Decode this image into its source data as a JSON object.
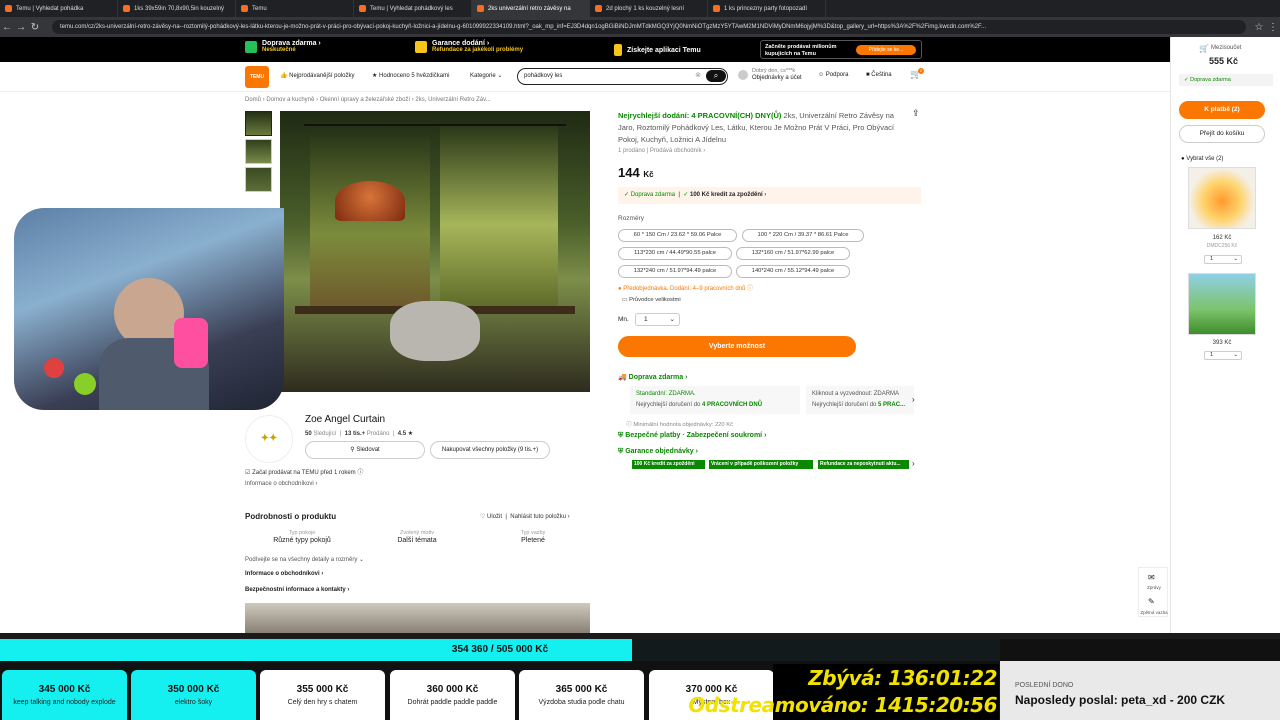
{
  "browser": {
    "tabs": [
      "Temu | Vyhledat pohádka",
      "1ks 39x59in 70,8x90,5in kouzelný",
      "Temu",
      "Temu | Vyhledat pohádkový les",
      "2ks univerzální retro závěsy na",
      "2d plochý 1 ks kouzelný lesní",
      "1 ks princezny party fotopozadí"
    ],
    "active_tab": 4,
    "url": "temu.com/cz/2ks-univerzální-retro-závěsy-na--roztomilý-pohádkový-les-látku-kterou-je-možno-prát-v-práci-pro-obývací-pokoj-kuchyň-ložnici-a-jídelnu-g-601099922334109.html?_oak_mp_inf=EJ3D4dqn1ogBGiBiNDJmMTdkMGQ3YjQ0NmNiOTgzMzY5YTAwM2M1NDViMyDNmM6ojyjM%3D&top_gallery_url=https%3A%2F%2Fimg.kwcdn.com%2F..."
  },
  "promo": {
    "free_shipping": "Doprava zdarma",
    "free_shipping_sub": "Neskutečné",
    "guarantee": "Garance dodání",
    "guarantee_sub": "Refundace za jakékoli problémy",
    "app": "Získejte aplikaci Temu",
    "selling_title": "Začněte prodávat milionům kupujících na Temu",
    "selling_cta": "Přidejte se ke..."
  },
  "header": {
    "logo": "TEMU",
    "bestsellers": "Nejprodávanější položky",
    "rated": "Hodnoceno 5 hvězdičkami",
    "categories": "Kategorie",
    "search_value": "pohádkový les",
    "account_line1": "Dobrý den, cs***k",
    "account_line2": "Objednávky a účet",
    "support": "Podpora",
    "language": "Čeština",
    "cart_count": "2"
  },
  "breadcrumb": "Domů  ›  Domov a kuchyně  ›  Okenní úpravy a železářské zboží  ›  2ks, Univerzální Retro Záv...",
  "product": {
    "delivery_prefix": "Nejrychlejší dodání: 4 PRACOVNÍ(CH) DNY(Ů)",
    "title": "2ks, Univerzální Retro Závěsy na Jaro, Roztomilý Pohádkový Les, Látku, Kterou Je Možno Prát V Práci, Pro Obývací Pokoj, Kuchyň, Ložnici A Jídelnu",
    "sold": "1 prodáno  |  Prodává obchodník",
    "price": "144",
    "currency": "Kč",
    "benefit_1": "Doprava zdarma",
    "benefit_2": "100 Kč kredit za zpoždění",
    "sizes_label": "Rozměry",
    "sizes": [
      "60 * 150 Cm / 23.62 * 59.06 Palce",
      "100 * 220 Cm / 39.37 * 86.61 Palce",
      "113*230 cm / 44.49*90.55 palce",
      "132*160 cm / 51.97*62.99 palce",
      "132*240 cm / 51.97*94.49 palce",
      "140*240 cm / 55.12*94.49 palce"
    ],
    "preorder": "Předobjednávka. Dodání: 4–9 pracovních dnů",
    "size_guide": "Průvodce velikostmi",
    "qty_label": "Mn.",
    "qty_value": "1",
    "cta": "Vyberte možnost",
    "shipping_title": "Doprava zdarma",
    "ship_std_1": "Standardní: ZDARMA.",
    "ship_std_2": "Nejrychlejší doručení do",
    "ship_std_days": "4 PRACOVNÍCH DNŮ",
    "ship_click_1": "Kliknout a vyzvednout: ZDARMA",
    "ship_click_2": "Nejrychlejší doručení do",
    "ship_click_days": "5 PRAC...",
    "min_order": "Minimální hodnota objednávky: 220 Kč",
    "secure": "Bezpečné platby · Zabezpečení soukromí",
    "guarantee": "Garance objednávky",
    "badges": [
      "100 Kč kredit za zpoždění",
      "Vrácení v případě poškození položky",
      "Refundace za neposkytnutí aktu..."
    ]
  },
  "store": {
    "name": "Zoe Angel Curtain",
    "followers": "50",
    "followers_lbl": "Sledující",
    "sold": "13 tis.+",
    "sold_lbl": "Prodáno",
    "rating": "4.5",
    "follow_btn": "Sledovat",
    "buy_all_btn": "Nakupovat všechny položky (9 tis.+)",
    "since": "Začal prodávat na TEMU před 1 rokem",
    "info": "Informace o obchodníkovi"
  },
  "details": {
    "title": "Podrobnosti o produktu",
    "save": "Uložit",
    "report": "Nahlásit tuto položku",
    "attrs": [
      {
        "k": "Typ pokoje",
        "v": "Různé typy pokojů"
      },
      {
        "k": "Zvolený motiv",
        "v": "Další témata"
      },
      {
        "k": "Typ vazby",
        "v": "Pletené"
      }
    ],
    "see_all": "Podívejte se na všechny detaily a rozměry",
    "merchant_info": "Informace o obchodníkovi",
    "safety": "Bezpečnostní informace a kontakty"
  },
  "cart": {
    "subtotal_label": "Mezisoučet",
    "subtotal": "555 Kč",
    "free_shipping": "Doprava zdarma",
    "checkout": "K platbě (2)",
    "go_to_cart": "Přejít do košíku",
    "select_all": "Vybrat vše (2)",
    "items": [
      {
        "price": "162 Kč",
        "old": "DMDC256 Kč",
        "qty": "1"
      },
      {
        "price": "393 Kč",
        "qty": "1"
      }
    ],
    "side_1": "Zprávy",
    "side_2": "Zpětná vazba"
  },
  "overlay": {
    "progress_text": "354 360 / 505 000 Kč",
    "progress_fraction": 0.7017,
    "goals": [
      {
        "amount": "345 000 Kč",
        "label": "keep talking and nobody explode",
        "reached": true
      },
      {
        "amount": "350 000 Kč",
        "label": "elektro šoky",
        "reached": true
      },
      {
        "amount": "355 000 Kč",
        "label": "Celý den hry s chatem",
        "reached": false
      },
      {
        "amount": "360 000 Kč",
        "label": "Dohrát paddle paddle paddle",
        "reached": false
      },
      {
        "amount": "365 000 Kč",
        "label": "Výzdoba studia podle chatu",
        "reached": false
      },
      {
        "amount": "370 000 Kč",
        "label": "Mystery box",
        "reached": false
      }
    ],
    "remaining_label": "Zbývá:",
    "remaining": "136:01:22",
    "streamed_label": "Odstreamováno:",
    "streamed": "1415:20:56",
    "last_donation_head": "POSLEDNÍ DONO",
    "last_donation": "Naposledy poslal: peta_xd - 200 CZK"
  },
  "colors": {
    "temu_orange": "#fb7701",
    "temu_green": "#0a8800",
    "overlay_cyan": "#14f0f0",
    "timer_yellow": "#f2e200"
  }
}
